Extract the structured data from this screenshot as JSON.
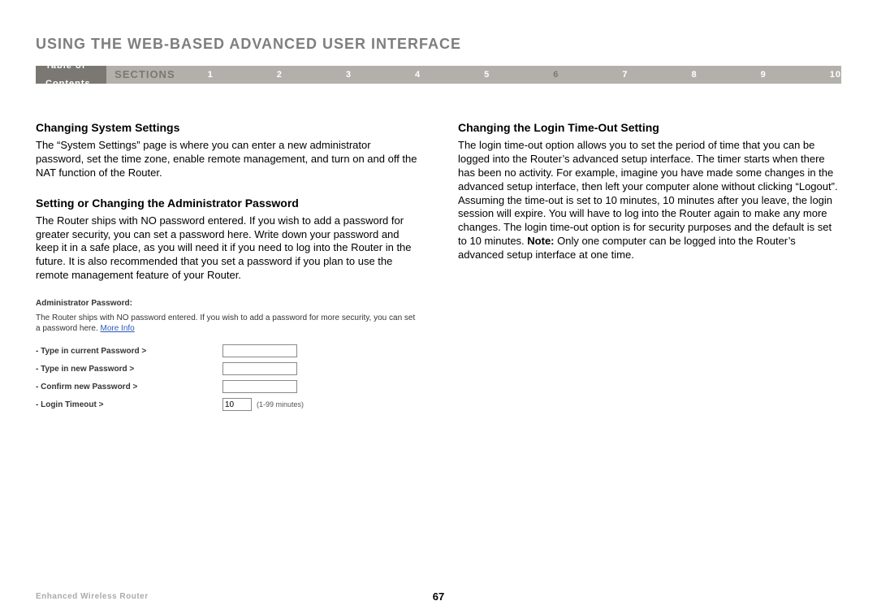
{
  "page_title": "USING THE WEB-BASED ADVANCED USER INTERFACE",
  "nav": {
    "toc": "Table of Contents",
    "sections_label": "SECTIONS",
    "items": [
      "1",
      "2",
      "3",
      "4",
      "5",
      "6",
      "7",
      "8",
      "9",
      "10"
    ],
    "active": "6"
  },
  "left": {
    "h1": "Changing System Settings",
    "p1": "The “System Settings” page is where you can enter a new administrator password, set the time zone, enable remote management, and turn on and off the NAT function of the Router.",
    "h2": "Setting or Changing the Administrator Password",
    "p2": "The Router ships with NO password entered. If you wish to add a password for greater security, you can set a password here. Write down your password and keep it in a safe place, as you will need it if you need to log into the Router in the future. It is also recommended that you set a password if you plan to use the remote management feature of your Router."
  },
  "form": {
    "title": "Administrator Password:",
    "desc_a": "The Router ships with NO password entered. If you wish to add a password for more security, you can set a password here. ",
    "more_info": "More Info",
    "row1": "- Type in current Password >",
    "row2": "- Type in new Password >",
    "row3": "- Confirm new Password >",
    "row4": "- Login Timeout >",
    "timeout_value": "10",
    "timeout_hint": "(1-99 minutes)"
  },
  "right": {
    "h1": "Changing the Login Time-Out Setting",
    "p1a": "The login time-out option allows you to set the period of time that you can be logged into the Router’s advanced setup interface. The timer starts when there has been no activity. For example, imagine you have made some changes in the advanced setup interface, then left your computer alone without clicking “Logout”. Assuming the time-out is set to 10 minutes, 10 minutes after you leave, the login session will expire. You will have to log into the Router again to make any more changes. The login time-out option is for security purposes and the default is set to 10 minutes. ",
    "note_label": "Note:",
    "p1b": " Only one computer can be logged into the Router’s advanced setup interface at one time."
  },
  "footer": {
    "product": "Enhanced Wireless Router",
    "page_number": "67"
  }
}
